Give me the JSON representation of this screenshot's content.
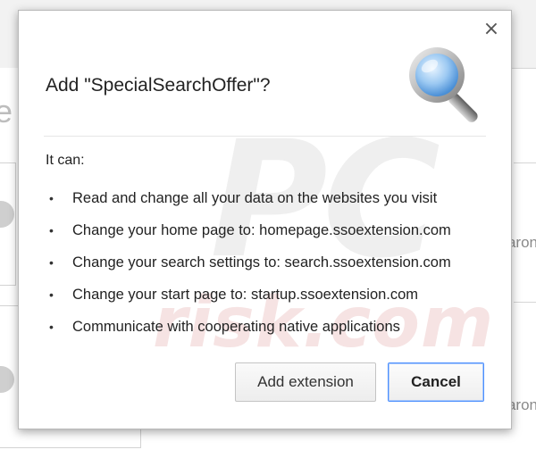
{
  "background": {
    "left_letter": "e",
    "right_snippet_1": "aron",
    "right_snippet_2": "aron"
  },
  "dialog": {
    "title": "Add \"SpecialSearchOffer\"?",
    "close_symbol": "×",
    "icon": "magnifier-icon",
    "intro": "It can:",
    "permissions": [
      "Read and change all your data on the websites you visit",
      "Change your home page to: homepage.ssoextension.com",
      "Change your search settings to: search.ssoextension.com",
      "Change your start page to: startup.ssoextension.com",
      "Communicate with cooperating native applications"
    ],
    "bullet": "•",
    "buttons": {
      "add_label": "Add extension",
      "cancel_label": "Cancel"
    }
  },
  "watermark": {
    "logo": "PC",
    "text": "risk.com"
  },
  "colors": {
    "focus_ring": "#4d90fe",
    "dialog_border": "#b9b9b9"
  }
}
